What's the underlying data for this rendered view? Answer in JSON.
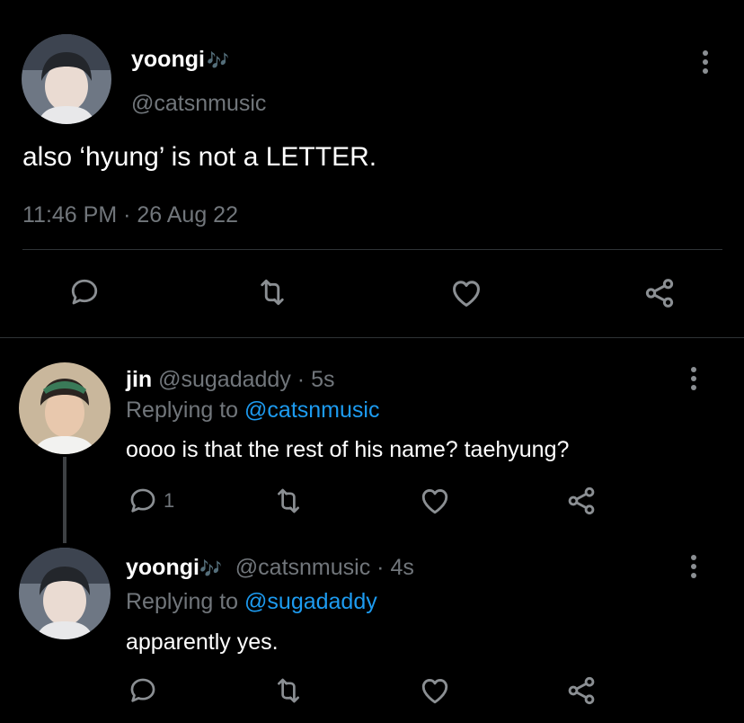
{
  "main_tweet": {
    "display_name": "yoongi",
    "name_emoji": "🎶",
    "handle": "@catsnmusic",
    "text": "also ‘hyung’ is not a LETTER.",
    "timestamp": "11:46 PM · 26 Aug 22",
    "actions": [
      "reply-icon",
      "retweet-icon",
      "like-icon",
      "share-icon"
    ]
  },
  "replies": [
    {
      "display_name": "jin",
      "handle": "@sugadaddy",
      "time": "· 5s",
      "replying_prefix": "Replying to",
      "replying_to": "@catsnmusic",
      "text": "oooo is that the rest of his name? taehyung?",
      "reply_count": "1"
    },
    {
      "display_name": "yoongi",
      "name_emoji": "🎶",
      "handle": "@catsnmusic",
      "time": "· 4s",
      "replying_prefix": "Replying to",
      "replying_to": "@sugadaddy",
      "text": "apparently yes."
    }
  ],
  "colors": {
    "background": "#000000",
    "text_primary": "#ffffff",
    "text_secondary": "#71767b",
    "mention": "#1d9bf0",
    "divider": "#2f3336"
  }
}
